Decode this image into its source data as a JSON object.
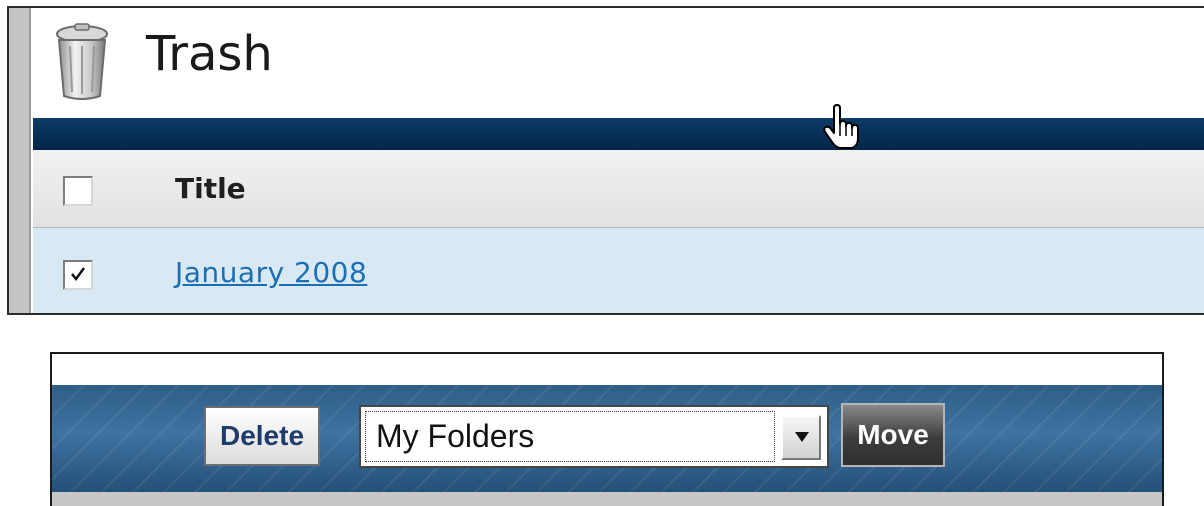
{
  "trash_panel": {
    "title": "Trash",
    "icon": "trash-can-icon",
    "table": {
      "columns": [
        "Title"
      ],
      "header_checkbox_checked": false,
      "rows": [
        {
          "title": "January 2008",
          "checked": true
        }
      ]
    }
  },
  "toolbar": {
    "delete_label": "Delete",
    "folder_select": {
      "value": "My Folders"
    },
    "move_label": "Move",
    "cursor": "hand-pointer-icon"
  },
  "colors": {
    "header_bar": "#01264a",
    "selected_row": "#d8e9f3",
    "link": "#1d6fb3",
    "toolbar": "#3f73a1"
  }
}
